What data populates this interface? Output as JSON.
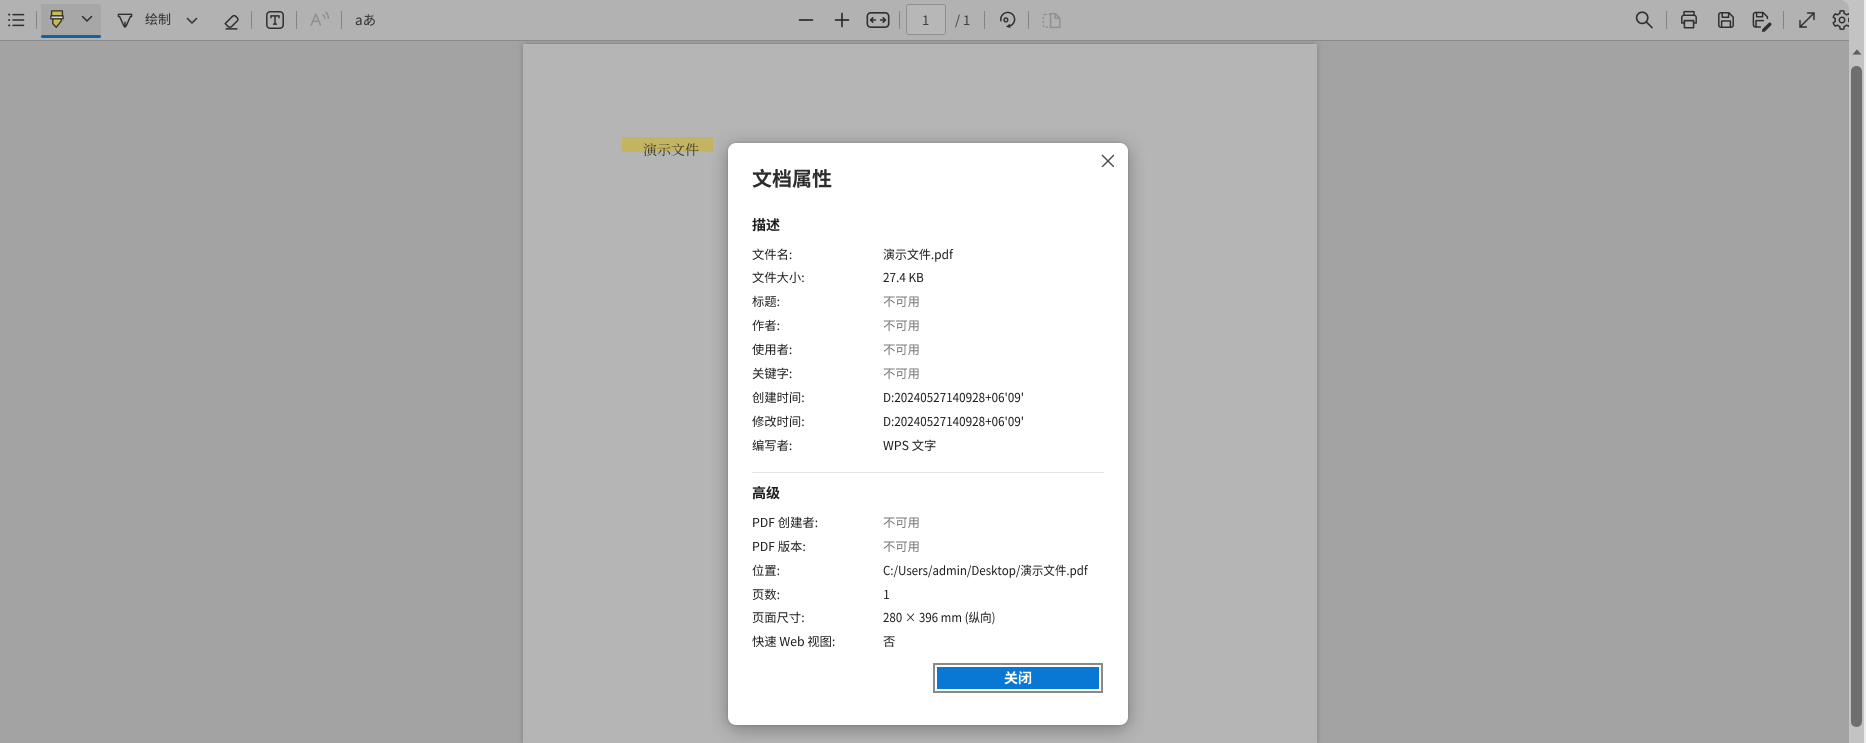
{
  "app": {
    "name": "pdf-viewer"
  },
  "toolbar": {
    "draw_label": "绘制",
    "read_language_label": "aあ",
    "page_input_value": "1",
    "page_total_label": "/ 1",
    "icons": [
      "toc-icon",
      "highlighter-icon",
      "chevron-down-icon",
      "pen-icon",
      "eraser-icon",
      "text-box-icon",
      "read-aloud-icon",
      "zoom-out-icon",
      "zoom-in-icon",
      "fit-to-width-icon",
      "rotate-icon",
      "page-view-icon",
      "search-icon",
      "print-icon",
      "save-icon",
      "save-as-icon",
      "fullscreen-icon",
      "settings-icon"
    ]
  },
  "document": {
    "page_text": "演示文件"
  },
  "dialog": {
    "title": "文档属性",
    "close_icon": "close-icon",
    "sections": [
      {
        "heading": "描述",
        "rows": [
          {
            "label": "文件名:",
            "value": "演示文件.pdf"
          },
          {
            "label": "文件大小:",
            "value": "27.4 KB"
          },
          {
            "label": "标题:",
            "value": "不可用"
          },
          {
            "label": "作者:",
            "value": "不可用"
          },
          {
            "label": "使用者:",
            "value": "不可用"
          },
          {
            "label": "关键字:",
            "value": "不可用"
          },
          {
            "label": "创建时间:",
            "value": "D:20240527140928+06'09'"
          },
          {
            "label": "修改时间:",
            "value": "D:20240527140928+06'09'"
          },
          {
            "label": "编写者:",
            "value": "WPS 文字"
          }
        ]
      },
      {
        "heading": "高级",
        "rows": [
          {
            "label": "PDF 创建者:",
            "value": "不可用"
          },
          {
            "label": "PDF 版本:",
            "value": "不可用"
          },
          {
            "label": "位置:",
            "value": "C:/Users/admin/Desktop/演示文件.pdf"
          },
          {
            "label": "页数:",
            "value": "1"
          },
          {
            "label": "页面尺寸:",
            "value": "280 × 396 mm (纵向)"
          },
          {
            "label": "快速 Web 视图:",
            "value": "否"
          }
        ]
      }
    ],
    "close_button_label": "关闭"
  },
  "colors": {
    "accent_blue": "#0878d4",
    "selected_tool_underline": "#0f63a6",
    "highlight_yellow": "#c3b462"
  }
}
